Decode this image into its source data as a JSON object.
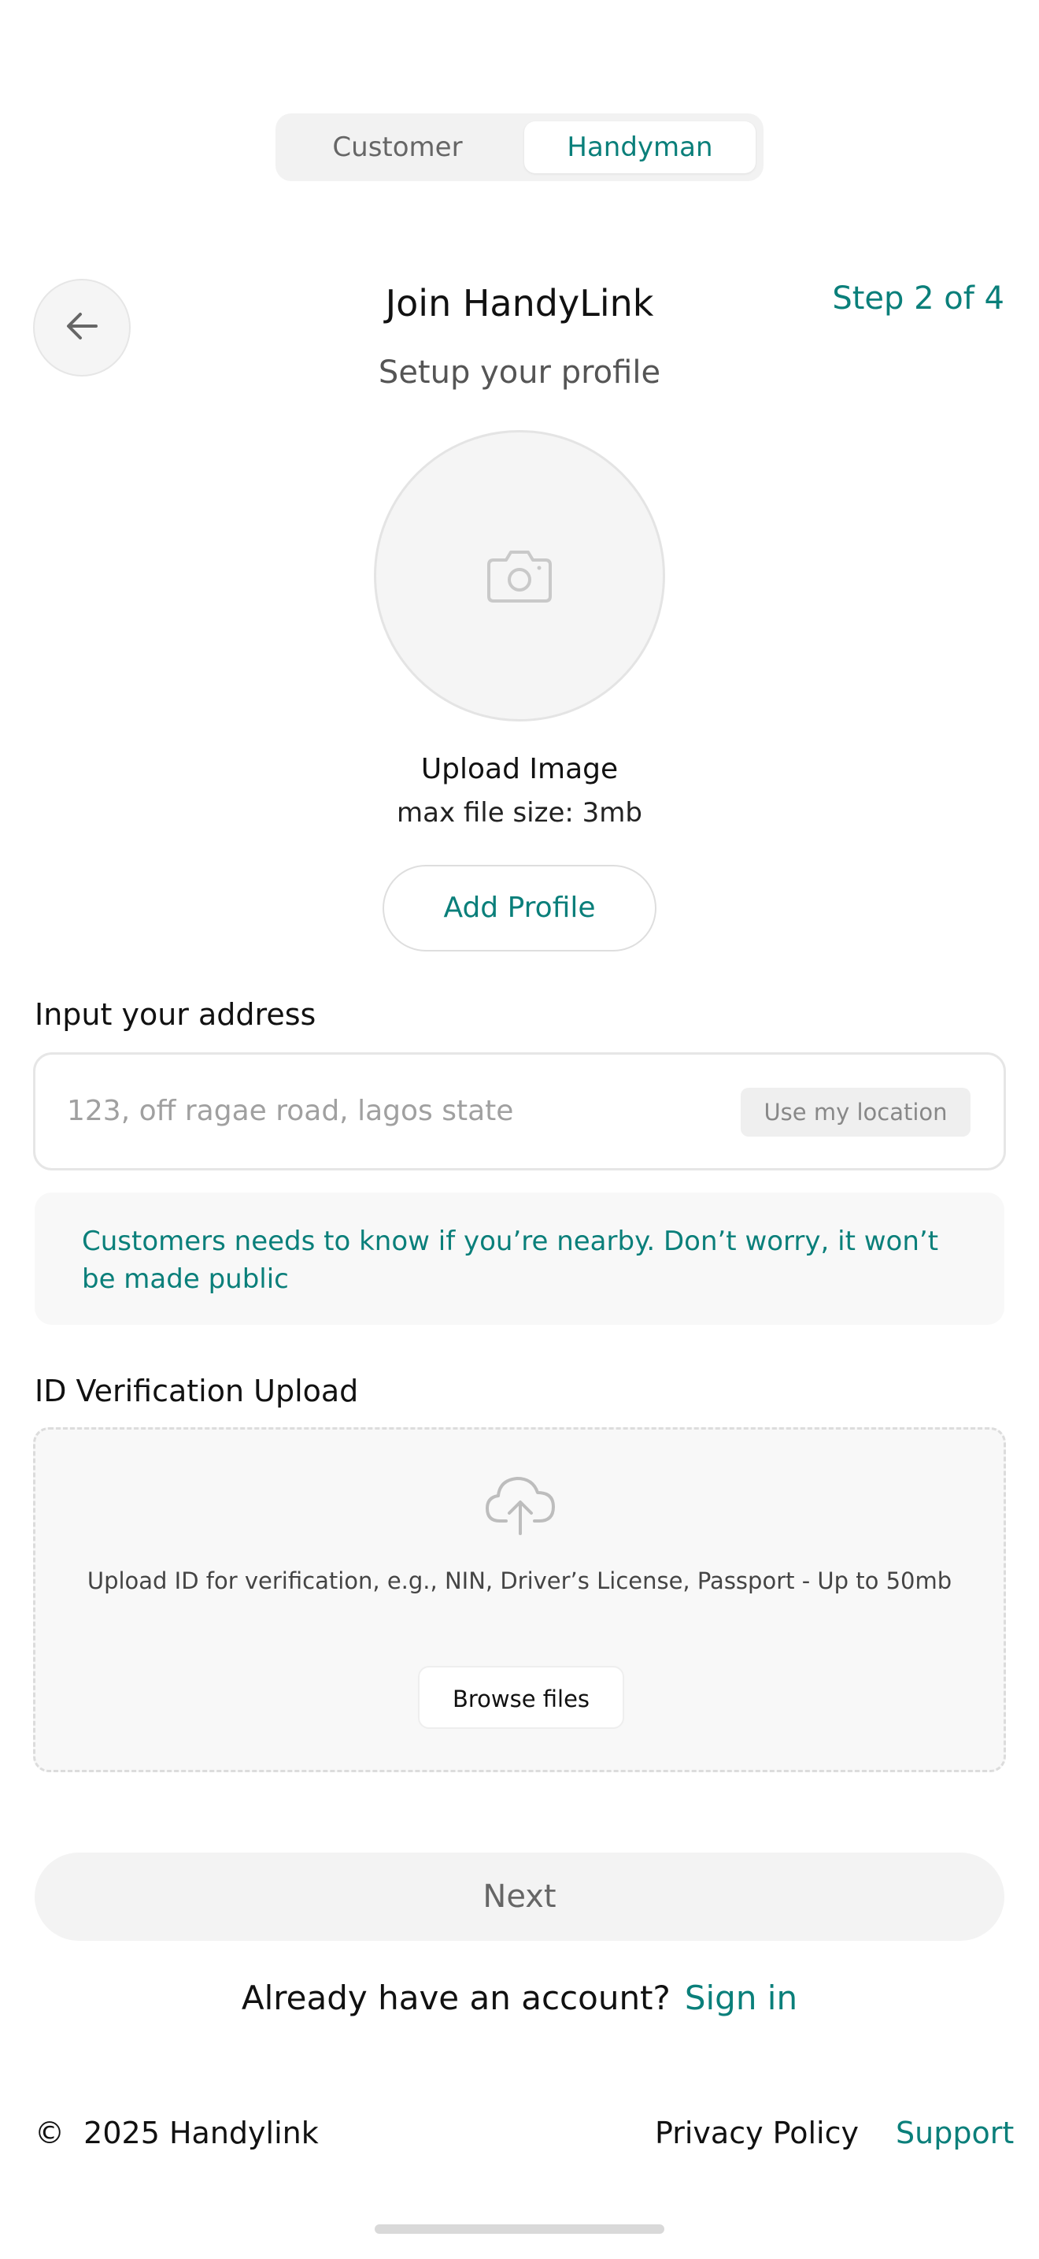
{
  "role_switch": {
    "customer": "Customer",
    "handyman": "Handyman",
    "selected": "Handyman"
  },
  "header": {
    "title": "Join HandyLink",
    "step": "Step 2 of 4",
    "subtitle": "Setup your profile"
  },
  "avatar_upload": {
    "label": "Upload Image",
    "size_hint": "max file size: 3mb",
    "button": "Add Profile"
  },
  "address": {
    "label": "Input your address",
    "placeholder": "123, off ragae road, lagos state",
    "use_location": "Use my location",
    "note": "Customers needs to know if you’re nearby. Don’t worry, it won’t be made public"
  },
  "id_upload": {
    "label": "ID Verification Upload",
    "hint": "Upload ID for verification, e.g., NIN, Driver’s License, Passport - Up to 50mb",
    "button": "Browse files"
  },
  "actions": {
    "next": "Next",
    "already": "Already have an account?",
    "signin": "Sign in"
  },
  "footer": {
    "copyright_symbol": "©",
    "copyright_text": "2025 Handylink",
    "privacy": "Privacy Policy",
    "support": "Support"
  },
  "colors": {
    "accent": "#0a7f7a",
    "surface": "#f5f5f5",
    "border": "#e6e6e6"
  },
  "icons": {
    "back": "arrow-left-icon",
    "camera": "camera-icon",
    "upload": "cloud-upload-icon"
  }
}
